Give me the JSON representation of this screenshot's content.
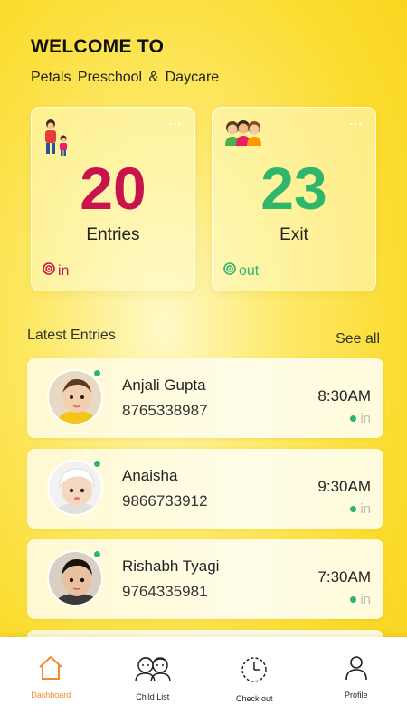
{
  "header": {
    "title": "WELCOME TO",
    "subtitle": "Petals  Preschool &  Daycare"
  },
  "stats": {
    "entries": {
      "count": "20",
      "label": "Entries",
      "status": "in",
      "icon": "parent-child-icon",
      "color": "#c8134f"
    },
    "exit": {
      "count": "23",
      "label": "Exit",
      "status": "out",
      "icon": "kids-group-icon",
      "color": "#2eb66c"
    },
    "more_label": "..."
  },
  "latest": {
    "title": "Latest Entries",
    "see_all": "See all",
    "items": [
      {
        "name": "Anjali Gupta",
        "phone": "8765338987",
        "time": "8:30AM",
        "status": "in"
      },
      {
        "name": "Anaisha",
        "phone": "9866733912",
        "time": "9:30AM",
        "status": "in"
      },
      {
        "name": "Rishabh Tyagi",
        "phone": "9764335981",
        "time": "7:30AM",
        "status": "in"
      }
    ]
  },
  "nav": {
    "items": [
      {
        "label": "Dashboard",
        "icon": "home-icon",
        "active": true
      },
      {
        "label": "Child List",
        "icon": "children-icon",
        "active": false
      },
      {
        "label": "Check out",
        "icon": "clock-icon",
        "active": false
      },
      {
        "label": "Profile",
        "icon": "person-icon",
        "active": false
      }
    ]
  },
  "colors": {
    "accent": "#f08a2a",
    "in": "#c8134f",
    "out": "#2eb66c",
    "background": "#fbdc2e"
  }
}
